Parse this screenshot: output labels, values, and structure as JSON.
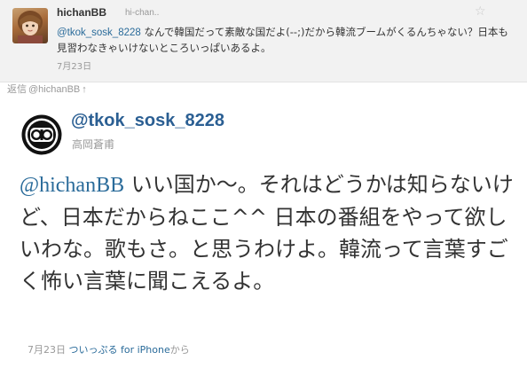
{
  "reply_tweet": {
    "screen_name": "hichanBB",
    "handle": "hi-chan..",
    "mention": "@tkok_sosk_8228",
    "text": " なんで韓国だって素敵な国だよ(--;)だから韓流ブームがくるんちゃない？日本も見習わなきゃいけないところいっぱいあるよ。",
    "date": "7月23日",
    "favorite_icon": "☆"
  },
  "in_reply_to": {
    "label": "返信",
    "user": "@hichanBB",
    "arrow": "↑"
  },
  "main_tweet": {
    "screen_name": "@tkok_sosk_8228",
    "full_name": "高岡蒼甫",
    "mention": "@hichanBB",
    "text": " いい国か〜。それはどうかは知らないけど、日本だからねここ^^ 日本の番組をやって欲しいわな。歌もさ。と思うわけよ。韓流って言葉すごく怖い言葉に聞こえるよ。",
    "date": "7月23日",
    "source": "ついっぷる for iPhone",
    "source_suffix": "から"
  }
}
